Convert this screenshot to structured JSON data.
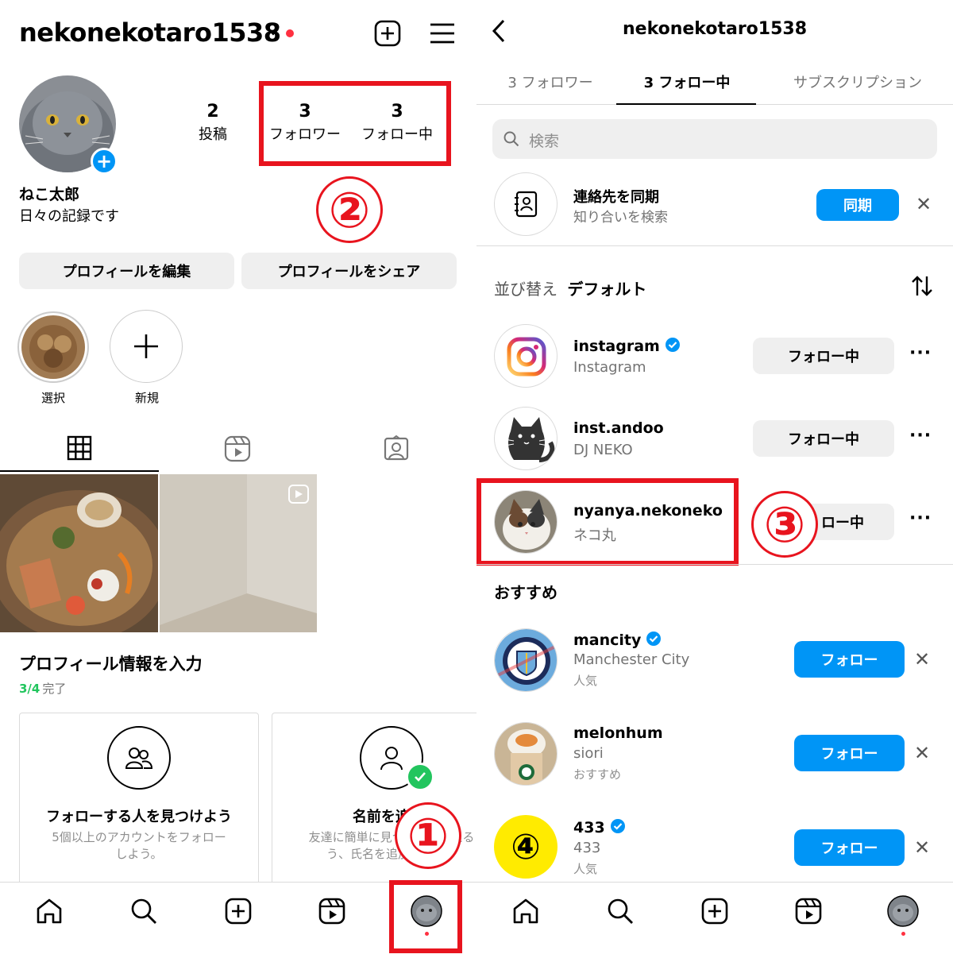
{
  "left": {
    "username": "nekonekotaro1538",
    "stats": [
      {
        "value": "2",
        "label": "投稿"
      },
      {
        "value": "3",
        "label": "フォロワー"
      },
      {
        "value": "3",
        "label": "フォロー中"
      }
    ],
    "display_name": "ねこ太郎",
    "bio": "日々の記録です",
    "edit_profile": "プロフィールを編集",
    "share_profile": "プロフィールをシェア",
    "highlights": [
      {
        "label": "選択"
      },
      {
        "label": "新規"
      }
    ],
    "profile_info_title": "プロフィール情報を入力",
    "progress_count": "3/4",
    "progress_suffix": "完了",
    "cards": [
      {
        "title": "フォローする人を見つけよう",
        "desc_line1": "5個以上のアカウントをフォロー",
        "desc_line2": "しよう。"
      },
      {
        "title": "名前を追加!",
        "desc_line1": "友達に簡単に見つけてもらえる",
        "desc_line2": "う、氏名を追加しよう。"
      }
    ],
    "annotations": {
      "one": "①",
      "two": "②"
    }
  },
  "right": {
    "title": "nekonekotaro1538",
    "tabs": [
      "3 フォロワー",
      "3 フォロー中",
      "サブスクリプション"
    ],
    "search_placeholder": "検索",
    "sync": {
      "title": "連絡先を同期",
      "subtitle": "知り合いを検索",
      "button": "同期"
    },
    "sort_label": "並び替え",
    "sort_value": "デフォルト",
    "following": [
      {
        "username": "instagram",
        "name": "Instagram",
        "button": "フォロー中"
      },
      {
        "username": "inst.andoo",
        "name": "DJ NEKO",
        "button": "フォロー中"
      },
      {
        "username": "nyanya.nekoneko",
        "name": "ネコ丸",
        "button": "ロー中"
      }
    ],
    "suggested_header": "おすすめ",
    "suggested": [
      {
        "username": "mancity",
        "name": "Manchester City",
        "note": "人気",
        "button": "フォロー"
      },
      {
        "username": "melonhum",
        "name": "siori",
        "note": "おすすめ",
        "button": "フォロー"
      },
      {
        "username": "433",
        "name": "433",
        "note": "人気",
        "button": "フォロー"
      }
    ],
    "logo_433": "④",
    "annotations": {
      "three": "③"
    }
  },
  "colors": {
    "blue": "#0095f6",
    "red_annotation": "#e8141e",
    "green": "#22c55e",
    "notification_red": "#ff3040"
  }
}
